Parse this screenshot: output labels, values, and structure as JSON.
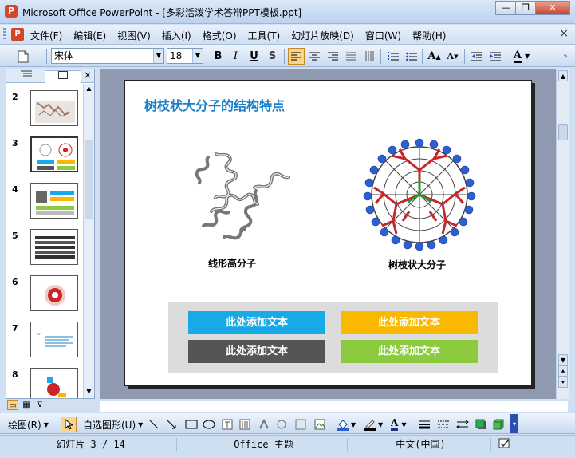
{
  "window": {
    "title": "Microsoft Office PowerPoint - [多彩活泼学术答辩PPT模板.ppt]",
    "minimize": "—",
    "restore": "❐",
    "close": "✕"
  },
  "menu": {
    "items": [
      "文件(F)",
      "编辑(E)",
      "视图(V)",
      "插入(I)",
      "格式(O)",
      "工具(T)",
      "幻灯片放映(D)",
      "窗口(W)",
      "帮助(H)"
    ],
    "close_glyph": "×"
  },
  "format_toolbar": {
    "font_name": "宋体",
    "font_size": "18",
    "bold": "B",
    "italic": "I",
    "underline": "U",
    "shadow": "S",
    "font_color_label": "A"
  },
  "left_panel": {
    "close_glyph": "×",
    "slide_numbers": [
      "2",
      "3",
      "4",
      "5",
      "6",
      "7",
      "8"
    ]
  },
  "slide": {
    "title": "树枝状大分子的结构特点",
    "left_label": "线形高分子",
    "right_label": "树枝状大分子",
    "boxes": [
      {
        "text": "此处添加文本",
        "color": "#19a9e6"
      },
      {
        "text": "此处添加文本",
        "color": "#fbb800"
      },
      {
        "text": "此处添加文本",
        "color": "#555555"
      },
      {
        "text": "此处添加文本",
        "color": "#8ccb3e"
      }
    ]
  },
  "draw_toolbar": {
    "draw_label": "绘图(R)",
    "autoshapes_label": "自选图形(U)"
  },
  "status": {
    "slide_counter": "幻灯片 3 / 14",
    "theme": "Office 主题",
    "language": "中文(中国)"
  },
  "colors": {
    "accent_title": "#1a7fc9",
    "dendrimer_red": "#c8262b",
    "dendrimer_blue": "#2e5fd0",
    "dendrimer_green": "#1f9a2f"
  }
}
